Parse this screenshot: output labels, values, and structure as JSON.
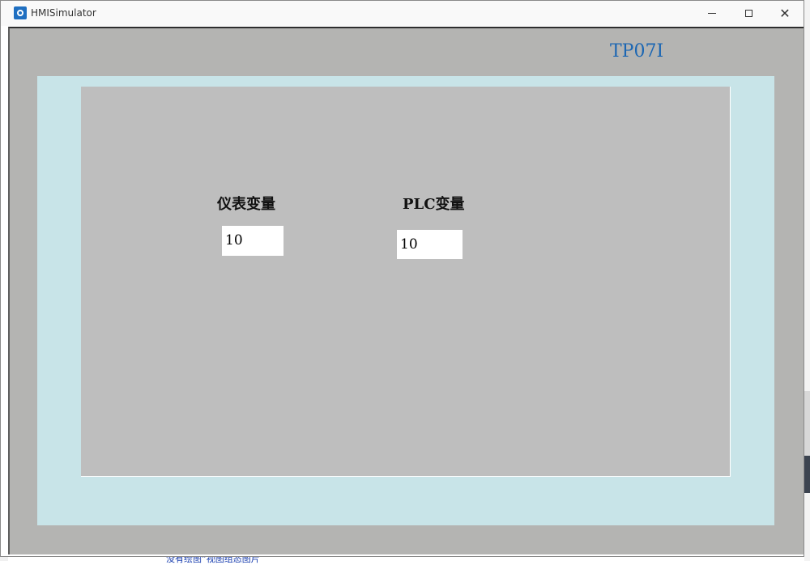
{
  "window": {
    "title": "HMISimulator",
    "controls": {
      "minimize": "minimize",
      "maximize": "maximize",
      "close": "close"
    }
  },
  "device": {
    "name": "TP07I"
  },
  "screen": {
    "meter_variable": {
      "label": "仪表变量",
      "value": "10"
    },
    "plc_variable": {
      "label": "PLC变量",
      "value": "10"
    }
  },
  "background": {
    "partial_text": "没有绘图“视图组态图片"
  },
  "colors": {
    "device_name": "#1b66b3",
    "bezel": "#c8e4e8",
    "screen": "#bebebe",
    "frame": "#b4b4b2"
  }
}
